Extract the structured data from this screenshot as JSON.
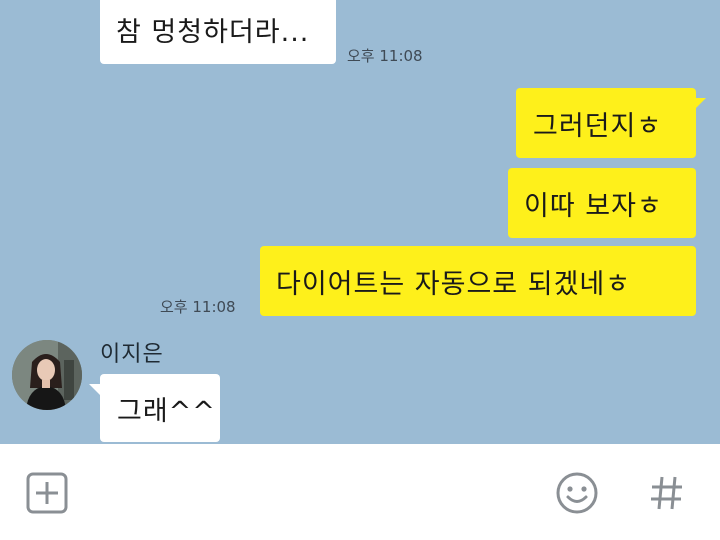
{
  "messages": [
    {
      "text": "참 멍청하더라...",
      "direction": "incoming"
    },
    {
      "time": "오후 11:08"
    },
    {
      "text": "그러던지ㅎ",
      "direction": "outgoing"
    },
    {
      "text": "이따 보자ㅎ",
      "direction": "outgoing"
    },
    {
      "text": "다이어트는 자동으로 되겠네ㅎ",
      "direction": "outgoing"
    },
    {
      "time": "오후 11:08"
    },
    {
      "sender": "이지은",
      "text": "그래^^",
      "direction": "incoming"
    }
  ],
  "colors": {
    "background": "#9bbbd4",
    "outgoing_bubble": "#fef01b",
    "incoming_bubble": "#ffffff",
    "input_bar": "#ffffff",
    "icon": "#8a8f94"
  },
  "input_bar": {
    "icons": [
      "plus-square-icon",
      "emoji-icon",
      "hash-icon"
    ]
  }
}
